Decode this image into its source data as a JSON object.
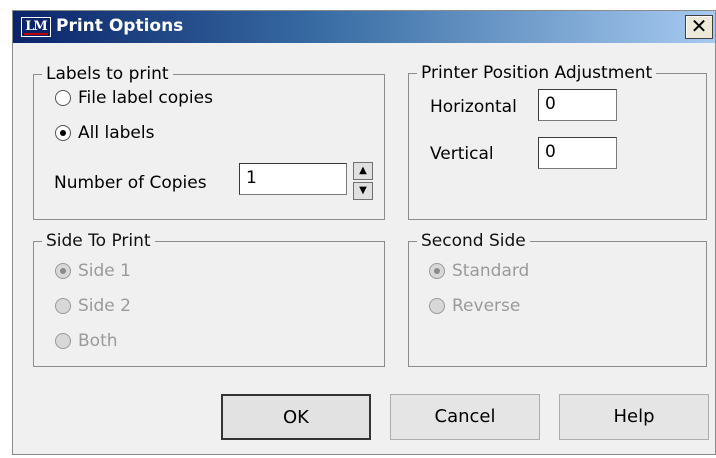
{
  "window": {
    "app_icon": "LM",
    "title": "Print Options",
    "close_label": "✕"
  },
  "labels_to_print": {
    "legend": "Labels to print",
    "options": [
      {
        "label": "File label copies",
        "checked": false
      },
      {
        "label": "All labels",
        "checked": true
      }
    ],
    "copies_label": "Number of Copies",
    "copies_value": "1",
    "spin_up": "▲",
    "spin_down": "▼"
  },
  "printer_position": {
    "legend": "Printer Position Adjustment",
    "horizontal_label": "Horizontal",
    "horizontal_value": "0",
    "vertical_label": "Vertical",
    "vertical_value": "0"
  },
  "side_to_print": {
    "legend": "Side To Print",
    "options": [
      {
        "label": "Side 1",
        "checked": true
      },
      {
        "label": "Side 2",
        "checked": false
      },
      {
        "label": "Both",
        "checked": false
      }
    ]
  },
  "second_side": {
    "legend": "Second Side",
    "options": [
      {
        "label": "Standard",
        "checked": true
      },
      {
        "label": "Reverse",
        "checked": false
      }
    ]
  },
  "buttons": {
    "ok": "OK",
    "cancel": "Cancel",
    "help": "Help"
  }
}
